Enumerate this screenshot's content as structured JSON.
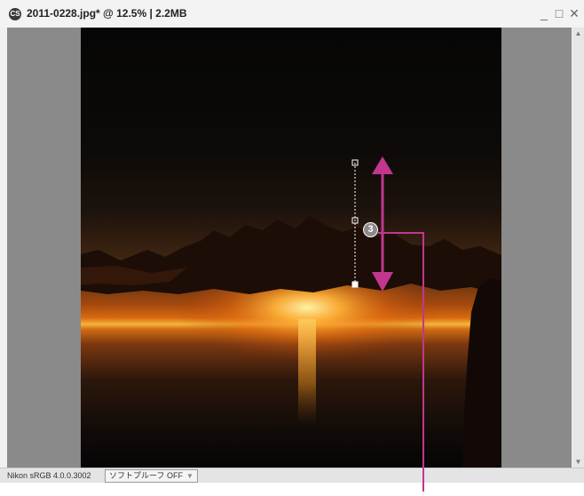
{
  "window": {
    "title": "2011-0228.jpg* @ 12.5% | 2.2MB",
    "app_icon_glyph": "CS",
    "minimize_glyph": "_",
    "maximize_glyph": "□",
    "close_glyph": "✕"
  },
  "status": {
    "profile": "Nikon sRGB 4.0.0.3002",
    "softproof_label": "ソフトプルーフ OFF",
    "dropdown_glyph": "▼"
  },
  "annotation": {
    "number": "3",
    "accent_color": "#c2368e"
  },
  "scrollbar": {
    "up_glyph": "▲",
    "down_glyph": "▼"
  }
}
